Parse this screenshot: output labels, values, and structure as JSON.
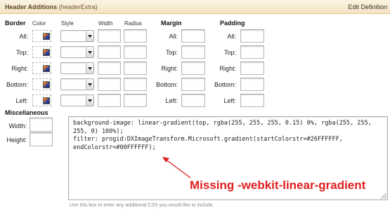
{
  "header": {
    "title": "Header Additions",
    "subtitle": "(headerExtra)",
    "edit_label": "Edit Definition"
  },
  "border": {
    "title": "Border",
    "columns": {
      "color": "Color",
      "style": "Style",
      "width": "Width",
      "radius": "Radius"
    },
    "rows": [
      "All:",
      "Top:",
      "Right:",
      "Bottom:",
      "Left:"
    ]
  },
  "margin": {
    "title": "Margin",
    "rows": [
      "All:",
      "Top:",
      "Right:",
      "Bottom:",
      "Left:"
    ]
  },
  "padding": {
    "title": "Padding",
    "rows": [
      "All:",
      "Top:",
      "Right:",
      "Bottom:",
      "Left:"
    ]
  },
  "misc": {
    "title": "Miscellaneous",
    "width_label": "Width:",
    "height_label": "Height:",
    "css_value": "background-image: linear-gradient(top, rgba(255, 255, 255, 0.15) 0%, rgba(255, 255, 255, 0) 100%);\nfilter: progid:DXImageTransform.Microsoft.gradient(startColorstr=#26FFFFFF, endColorstr=#00FFFFFF);",
    "hint": "Use this box to enter any additional CSS you would like to include."
  },
  "annotation": {
    "text": "Missing -webkit-linear-gradient",
    "color": "#e02020"
  },
  "colors": {
    "header_bg": "#f3e3c4",
    "header_border": "#e3c98f",
    "annotation_red": "#e02020"
  },
  "icons": {
    "color_picker": "color-picker-icon",
    "select_arrow": "chevron-down-icon",
    "resize": "resize-grip-icon"
  }
}
